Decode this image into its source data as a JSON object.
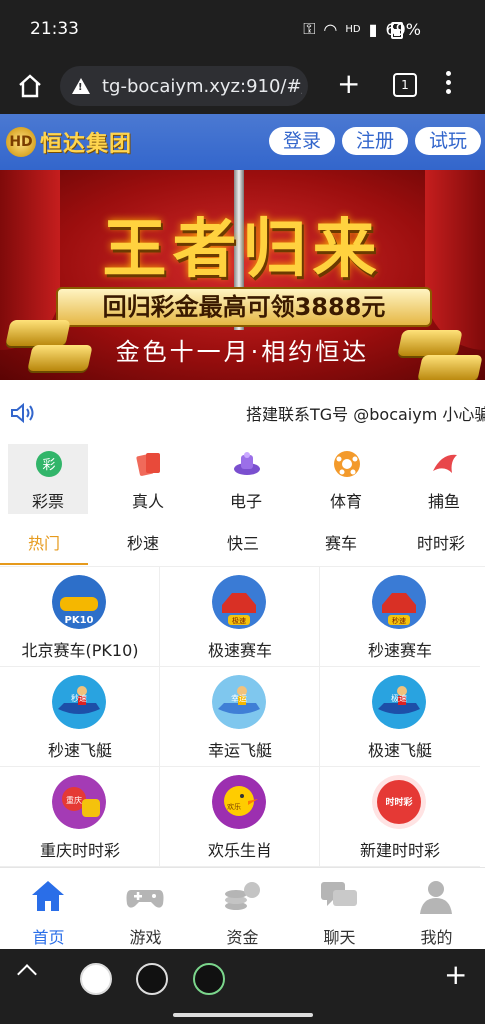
{
  "status": {
    "time": "21:33",
    "network": "HD",
    "battery": "69%"
  },
  "browser": {
    "url": "tg-bocaiym.xyz:910/#/",
    "tab_count": "1"
  },
  "header": {
    "logo_text": "恒达集团",
    "login": "登录",
    "register": "注册",
    "trial": "试玩"
  },
  "banner": {
    "title": "王者归来",
    "subtitle": "回归彩金最高可领3888元",
    "slogan": "金色十一月·相约恒达"
  },
  "notice": {
    "text": "搭建联系TG号 @bocaiym 小心骗"
  },
  "categories": [
    {
      "label": "彩票",
      "icon": "lottery-icon"
    },
    {
      "label": "真人",
      "icon": "cards-icon"
    },
    {
      "label": "电子",
      "icon": "slot-machine-icon"
    },
    {
      "label": "体育",
      "icon": "soccer-ball-icon"
    },
    {
      "label": "捕鱼",
      "icon": "fish-icon"
    }
  ],
  "subtabs": [
    "热门",
    "秒速",
    "快三",
    "赛车",
    "时时彩"
  ],
  "games": [
    {
      "name": "北京赛车(PK10)",
      "icon": "pk10-car-icon"
    },
    {
      "name": "极速赛车",
      "icon": "racing-car-icon"
    },
    {
      "name": "秒速赛车",
      "icon": "racing-car-icon"
    },
    {
      "name": "秒速飞艇",
      "icon": "jet-ski-icon"
    },
    {
      "name": "幸运飞艇",
      "icon": "jet-ski-icon"
    },
    {
      "name": "极速飞艇",
      "icon": "jet-ski-icon"
    },
    {
      "name": "重庆时时彩",
      "icon": "coins-ball-icon"
    },
    {
      "name": "欢乐生肖",
      "icon": "zodiac-chick-icon"
    },
    {
      "name": "新建时时彩",
      "icon": "ssc-ball-icon"
    }
  ],
  "game_icon_labels": [
    "PK10",
    "极速",
    "秒速",
    "秒速",
    "幸运",
    "极速",
    "重庆",
    "欢乐",
    "时时彩"
  ],
  "bottom_nav": [
    {
      "label": "首页",
      "icon": "home-icon"
    },
    {
      "label": "游戏",
      "icon": "gamepad-icon"
    },
    {
      "label": "资金",
      "icon": "coins-icon"
    },
    {
      "label": "聊天",
      "icon": "chat-icon"
    },
    {
      "label": "我的",
      "icon": "user-icon"
    }
  ],
  "colors": {
    "brand_blue": "#3366cc",
    "active_orange": "#e69a1c",
    "nav_active": "#2a6ee8"
  }
}
